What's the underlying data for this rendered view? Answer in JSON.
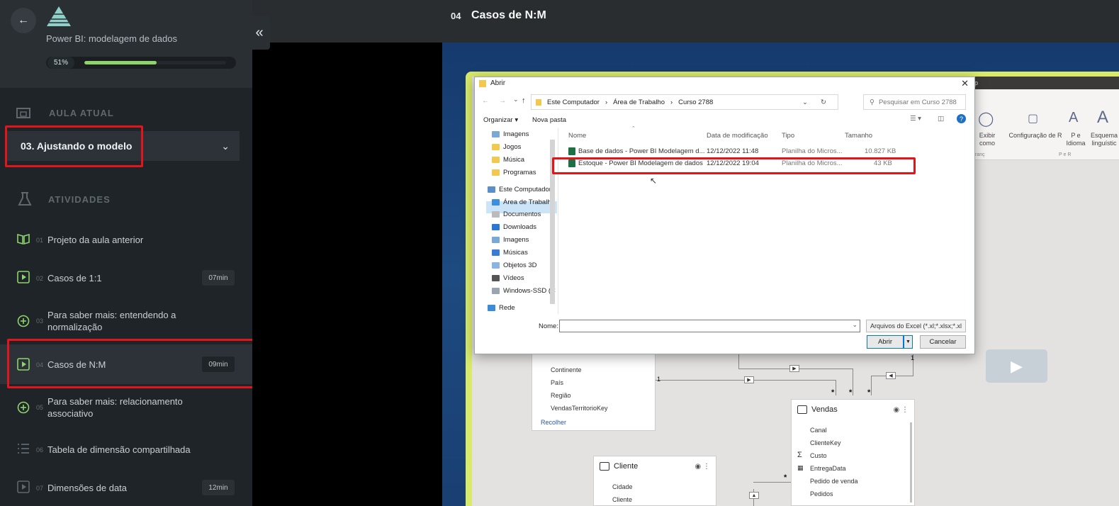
{
  "sidebar": {
    "course_title": "Power BI: modelagem de dados",
    "progress_label": "51%",
    "progress_value": 0.51,
    "section_current": "AULA ATUAL",
    "current_lesson": "03. Ajustando o modelo",
    "section_activities": "ATIVIDADES",
    "activities": [
      {
        "num": "01",
        "title": "Projeto da aula anterior",
        "duration": "",
        "icon": "book-icon"
      },
      {
        "num": "02",
        "title": "Casos de 1:1",
        "duration": "07min",
        "icon": "video-icon"
      },
      {
        "num": "03",
        "title": "Para saber mais: entendendo a normalização",
        "duration": "",
        "icon": "plus-circle-icon"
      },
      {
        "num": "04",
        "title": "Casos de N:M",
        "duration": "09min",
        "icon": "video-icon"
      },
      {
        "num": "05",
        "title": "Para saber mais: relacionamento associativo",
        "duration": "",
        "icon": "plus-circle-icon"
      },
      {
        "num": "06",
        "title": "Tabela de dimensão compartilhada",
        "duration": "",
        "icon": "list-icon"
      },
      {
        "num": "07",
        "title": "Dimensões de data",
        "duration": "12min",
        "icon": "video-icon"
      }
    ]
  },
  "header": {
    "lesson_number": "04",
    "lesson_title": "Casos de N:M"
  },
  "video": {
    "ribbon": {
      "fragment_title": "p",
      "items": [
        "Exibir como",
        "Configuração de R",
        "P e Idioma",
        "Esquema linguístic"
      ],
      "group_labels": [
        "ranç",
        "P e R"
      ]
    },
    "dialog": {
      "title": "Abrir",
      "breadcrumb": [
        "Este Computador",
        "Área de Trabalho",
        "Curso 2788"
      ],
      "search_placeholder": "Pesquisar em Curso 2788",
      "organize": "Organizar ▾",
      "new_folder": "Nova pasta",
      "nav_items": [
        "Imagens",
        "Jogos",
        "Música",
        "Programas",
        "Este Computador",
        "Área de Trabalh",
        "Documentos",
        "Downloads",
        "Imagens",
        "Músicas",
        "Objetos 3D",
        "Vídeos",
        "Windows-SSD (C",
        "Rede"
      ],
      "columns": [
        "Nome",
        "Data de modificação",
        "Tipo",
        "Tamanho"
      ],
      "files": [
        {
          "name": "Base de dados - Power BI Modelagem d...",
          "date": "12/12/2022 11:48",
          "type": "Planilha do Micros...",
          "size": "10.827 KB"
        },
        {
          "name": "Estoque - Power BI Modelagem de dados",
          "date": "12/12/2022 19:04",
          "type": "Planilha do Micros...",
          "size": "43 KB"
        }
      ],
      "name_label": "Nome:",
      "filter": "Arquivos do Excel (*.xl;*.xlsx;*.xl",
      "open_button": "Abrir",
      "cancel_button": "Cancelar"
    },
    "model": {
      "card1_fields": [
        "Continente",
        "País",
        "Região",
        "VendasTerritorioKey"
      ],
      "card1_collapse": "Recolher",
      "vendas_title": "Vendas",
      "vendas_fields": [
        "Canal",
        "ClienteKey",
        "Custo",
        "EntregaData",
        "Pedido de venda",
        "Pedidos"
      ],
      "cliente_title": "Cliente",
      "cliente_fields": [
        "Cidade",
        "Cliente"
      ],
      "rel_one": "1",
      "rel_many": "*"
    }
  }
}
